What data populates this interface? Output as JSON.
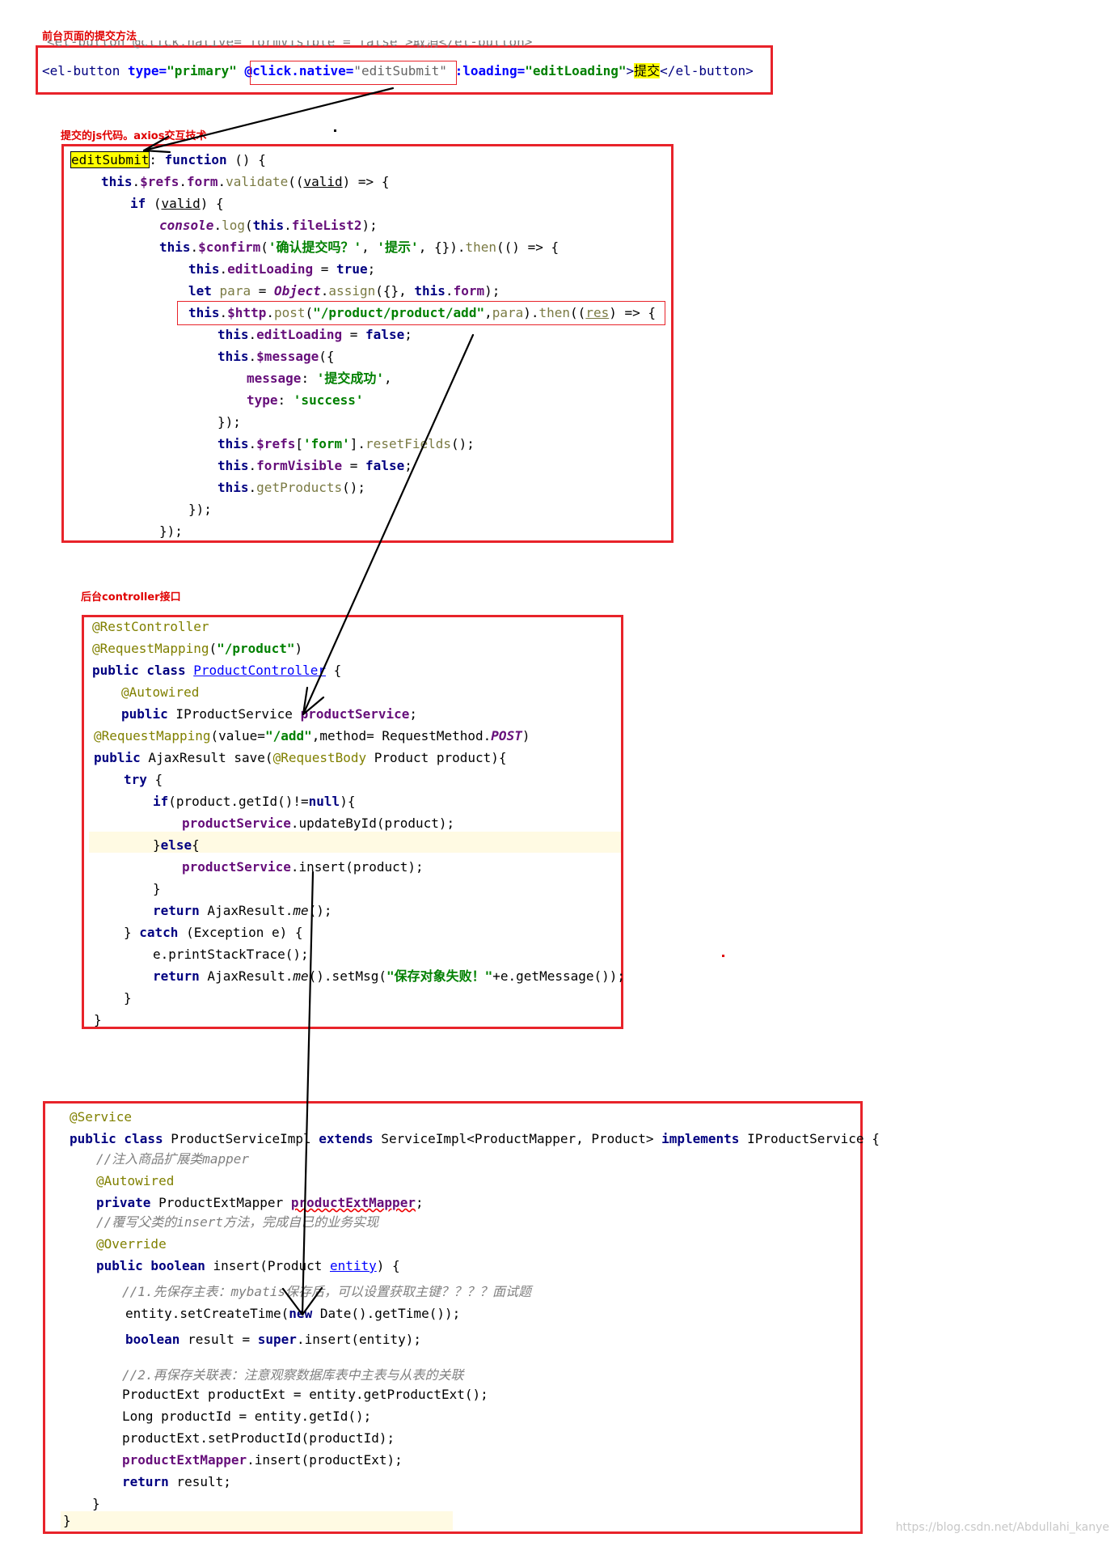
{
  "labels": {
    "frontend": "前台页面的提交方法",
    "js": "提交的js代码。axios交互技术",
    "controller": "后台controller接口"
  },
  "frontend_code": {
    "cutoff_line": "<el-button @click.native=\"formVisible = false\">取消</el-button>",
    "tag_open": "<el-button",
    "attr_type": "type=",
    "val_type": "\"primary\"",
    "attr_click": "@click.native=",
    "val_click": "\"editSubmit\"",
    "attr_loading": ":loading=",
    "val_loading": "\"editLoading\"",
    "gt": ">",
    "text": "提交",
    "tag_close": "</el-button>"
  },
  "js_code": [
    "editSubmit: function () {",
    "this.$refs.form.validate((valid) => {",
    "if (valid) {",
    "console.log(this.fileList2);",
    "this.$confirm('确认提交吗？', '提示', {}).then(() => {",
    "this.editLoading = true;",
    "let para = Object.assign({}, this.form);",
    "this.$http.post(\"/product/product/add\",para).then((res) => {",
    "this.editLoading = false;",
    "this.$message({",
    "message: '提交成功',",
    "type: 'success'",
    "});",
    "this.$refs['form'].resetFields();",
    "this.formVisible = false;",
    "this.getProducts();",
    "});",
    "});"
  ],
  "controller_code": [
    "@RestController",
    "@RequestMapping(\"/product\")",
    "public class ProductController {",
    "@Autowired",
    "public IProductService productService;",
    "@RequestMapping(value=\"/add\",method= RequestMethod.POST)",
    "public AjaxResult save(@RequestBody Product product){",
    "try {",
    "if(product.getId()!=null){",
    "productService.updateById(product);",
    "}else{",
    "productService.insert(product);",
    "}",
    "return AjaxResult.me();",
    "} catch (Exception e) {",
    "e.printStackTrace();",
    "return AjaxResult.me().setMsg(\"保存对象失败！\"+e.getMessage());",
    "}",
    "}"
  ],
  "service_code": [
    "@Service",
    "public class ProductServiceImpl extends ServiceImpl<ProductMapper, Product> implements IProductService {",
    "//注入商品扩展类mapper",
    "@Autowired",
    "private ProductExtMapper productExtMapper;",
    "//覆写父类的insert方法，完成自己的业务实现",
    "@Override",
    "public boolean insert(Product entity) {",
    "//1.先保存主表：mybatis保存后，可以设置获取主键？？？？面试题",
    "entity.setCreateTime(new Date().getTime());",
    "boolean result = super.insert(entity);",
    "//2.再保存关联表：注意观察数据库表中主表与从表的关联",
    "ProductExt productExt = entity.getProductExt();",
    "Long productId = entity.getId();",
    "productExt.setProductId(productId);",
    "productExtMapper.insert(productExt);",
    "return result;",
    "}",
    "}"
  ],
  "watermark": "https://blog.csdn.net/Abdullahi_kanye",
  "colors": {
    "box": "#e8232a",
    "highlight": "#ffff00",
    "keyword": "#000080",
    "string": "#008000",
    "annotation": "#808000",
    "field": "#660e7a",
    "comment": "#808080"
  }
}
